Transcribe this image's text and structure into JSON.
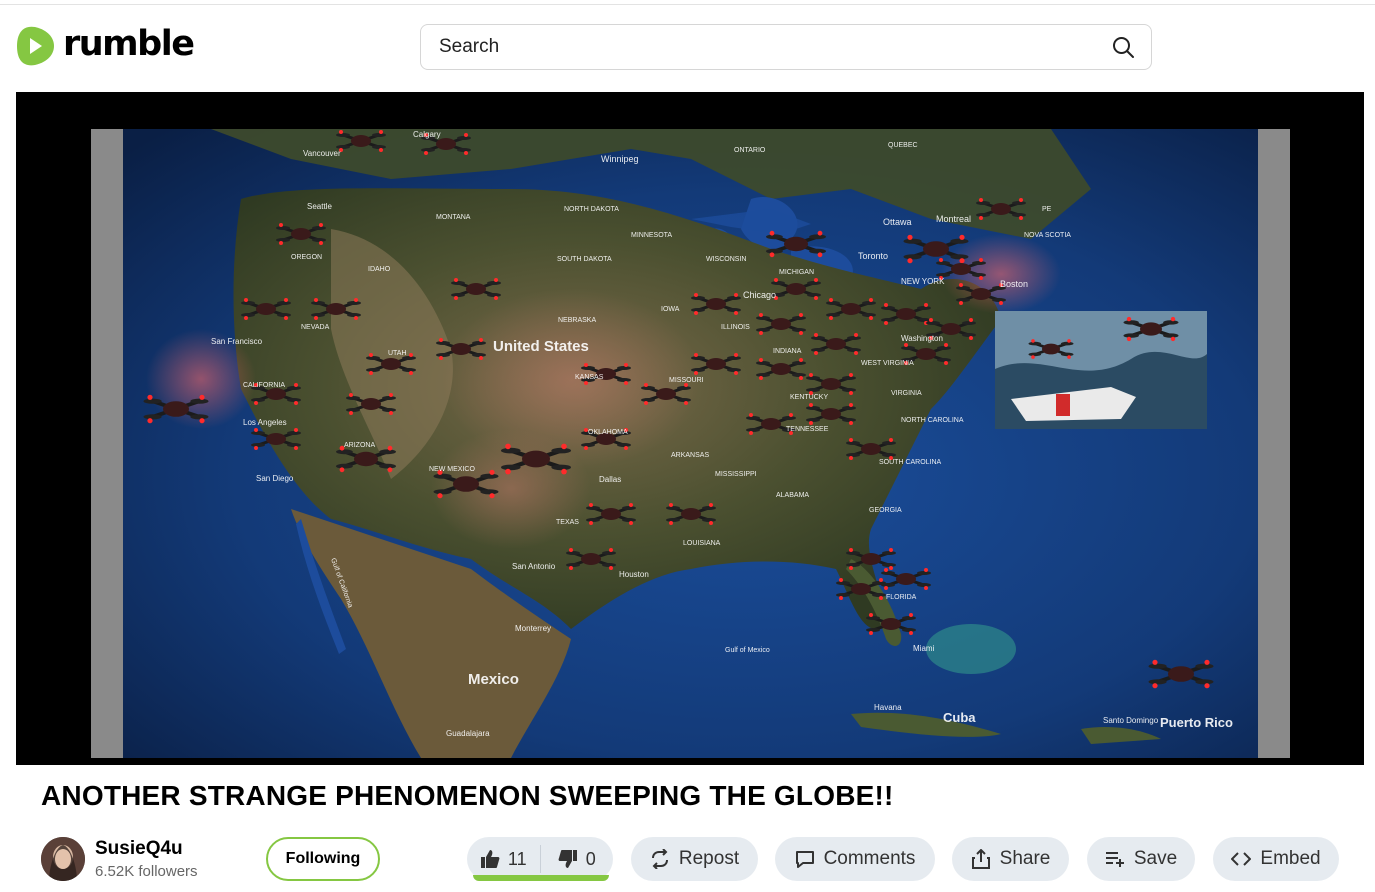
{
  "brand": {
    "name": "rumble",
    "color": "#85c742"
  },
  "search": {
    "placeholder": "Search",
    "icon": "search-icon"
  },
  "video": {
    "title": "ANOTHER STRANGE PHENOMENON SWEEPING THE GLOBE!!",
    "map_labels": {
      "united_states": "United States",
      "mexico": "Mexico",
      "cuba": "Cuba",
      "puerto_rico": "Puerto Rico",
      "boston": "Boston",
      "new_york": "NEW YORK",
      "ottawa": "Ottawa",
      "montreal": "Montreal",
      "toronto": "Toronto",
      "chicago": "Chicago",
      "winnipeg": "Winnipeg",
      "ontario": "ONTARIO",
      "quebec": "QUEBEC",
      "vancouver": "Vancouver",
      "calgary": "Calgary",
      "seattle": "Seattle",
      "oregon": "OREGON",
      "idaho": "IDAHO",
      "montana": "MONTANA",
      "north_dakota": "NORTH DAKOTA",
      "south_dakota": "SOUTH DAKOTA",
      "minnesota": "MINNESOTA",
      "wisconsin": "WISCONSIN",
      "michigan": "MICHIGAN",
      "nebraska": "NEBRASKA",
      "iowa": "IOWA",
      "illinois": "ILLINOIS",
      "indiana": "INDIANA",
      "san_francisco": "San Francisco",
      "california": "CALIFORNIA",
      "los_angeles": "Los Angeles",
      "san_diego": "San Diego",
      "arizona": "ARIZONA",
      "utah": "UTAH",
      "nevada": "NEVADA",
      "new_mexico": "NEW MEXICO",
      "kansas": "KANSAS",
      "missouri": "MISSOURI",
      "oklahoma": "OKLAHOMA",
      "arkansas": "ARKANSAS",
      "mississippi": "MISSISSIPPI",
      "alabama": "ALABAMA",
      "georgia": "GEORGIA",
      "tennessee": "TENNESSEE",
      "kentucky": "KENTUCKY",
      "west_virginia": "WEST VIRGINIA",
      "virginia": "VIRGINIA",
      "north_carolina": "NORTH CAROLINA",
      "south_carolina": "SOUTH CAROLINA",
      "florida": "FLORIDA",
      "texas": "TEXAS",
      "louisiana": "LOUISIANA",
      "dallas": "Dallas",
      "houston": "Houston",
      "san_antonio": "San Antonio",
      "miami": "Miami",
      "nova_scotia": "NOVA SCOTIA",
      "pe": "PE",
      "washington": "Washington",
      "gulf_of_mexico": "Gulf of Mexico",
      "gulf_of_california": "Gulf of California",
      "monterrey": "Monterrey",
      "guadalajara": "Guadalajara",
      "havana": "Havana",
      "santo_domingo": "Santo Domingo"
    }
  },
  "channel": {
    "name": "SusieQ4u",
    "followers": "6.52K followers",
    "follow_label": "Following"
  },
  "votes": {
    "up": "11",
    "down": "0",
    "up_fraction": 1.0
  },
  "actions": {
    "repost": "Repost",
    "comments": "Comments",
    "share": "Share",
    "save": "Save",
    "embed": "Embed"
  }
}
